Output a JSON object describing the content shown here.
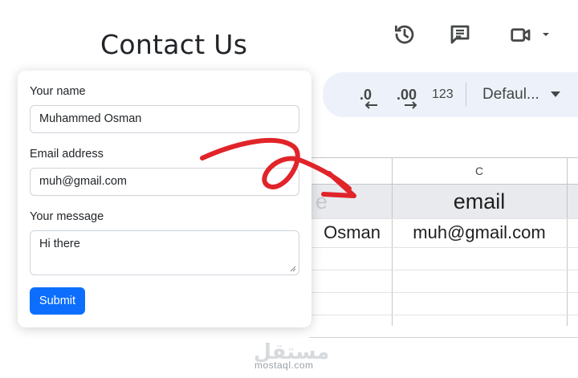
{
  "form": {
    "title": "Contact Us",
    "name_label": "Your name",
    "name_value": "Muhammed Osman",
    "email_label": "Email address",
    "email_value": "muh@gmail.com",
    "message_label": "Your message",
    "message_value": "Hi there",
    "submit_label": "Submit",
    "accent_color": "#0d6efd"
  },
  "sheets": {
    "toolbar": {
      "decrease_decimal": ".0",
      "increase_decimal": ".00",
      "format_number": "123",
      "font_select": "Defaul..."
    },
    "top_icons": [
      "history-icon",
      "comment-icon",
      "video-call-icon"
    ],
    "column_header": "C",
    "partial_header_text": "e",
    "header_cell": "email",
    "partial_data_text": "Osman",
    "data_cell": "muh@gmail.com"
  },
  "annotation": {
    "arrow_color": "#e0242a"
  },
  "watermark": {
    "logo_text": "مستقل",
    "site": "mostaql.com"
  }
}
